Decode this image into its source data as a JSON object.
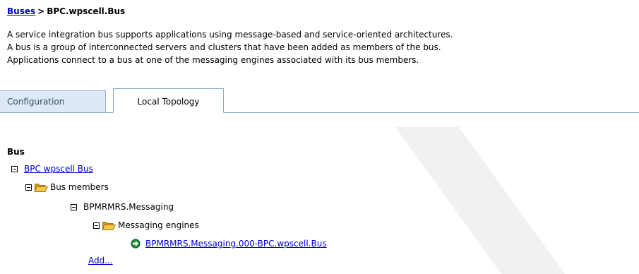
{
  "breadcrumb": {
    "parent_link": "Buses",
    "separator": ">",
    "current": "BPC.wpscell.Bus"
  },
  "description": {
    "lines": [
      "A service integration bus supports applications using message-based and service-oriented architectures.",
      "A bus is a group of interconnected servers and clusters that have been added as members of the bus.",
      "Applications connect to a bus at one of the messaging engines associated with its bus members."
    ]
  },
  "tabs": [
    {
      "label": "Configuration",
      "active": false
    },
    {
      "label": "Local Topology",
      "active": true
    }
  ],
  "topology": {
    "heading": "Bus",
    "bus_name": "BPC wpscell Bus",
    "bus_members_label": "Bus members",
    "member_name": "BPMRMRS.Messaging",
    "engines_label": "Messaging engines",
    "engine_name": "BPMRMRS.Messaging.000-BPC.wpscell.Bus",
    "add_link": "Add..."
  },
  "colors": {
    "link": "#0000cc",
    "tab_inactive_bg": "#dde9f4",
    "tab_border": "#8aa6c0",
    "folder": "#e8b020",
    "engine_icon": "#1e8a3a"
  },
  "icons": {
    "collapse": "minus-box-icon",
    "folder": "open-folder-icon",
    "engine": "messaging-engine-started-icon"
  }
}
